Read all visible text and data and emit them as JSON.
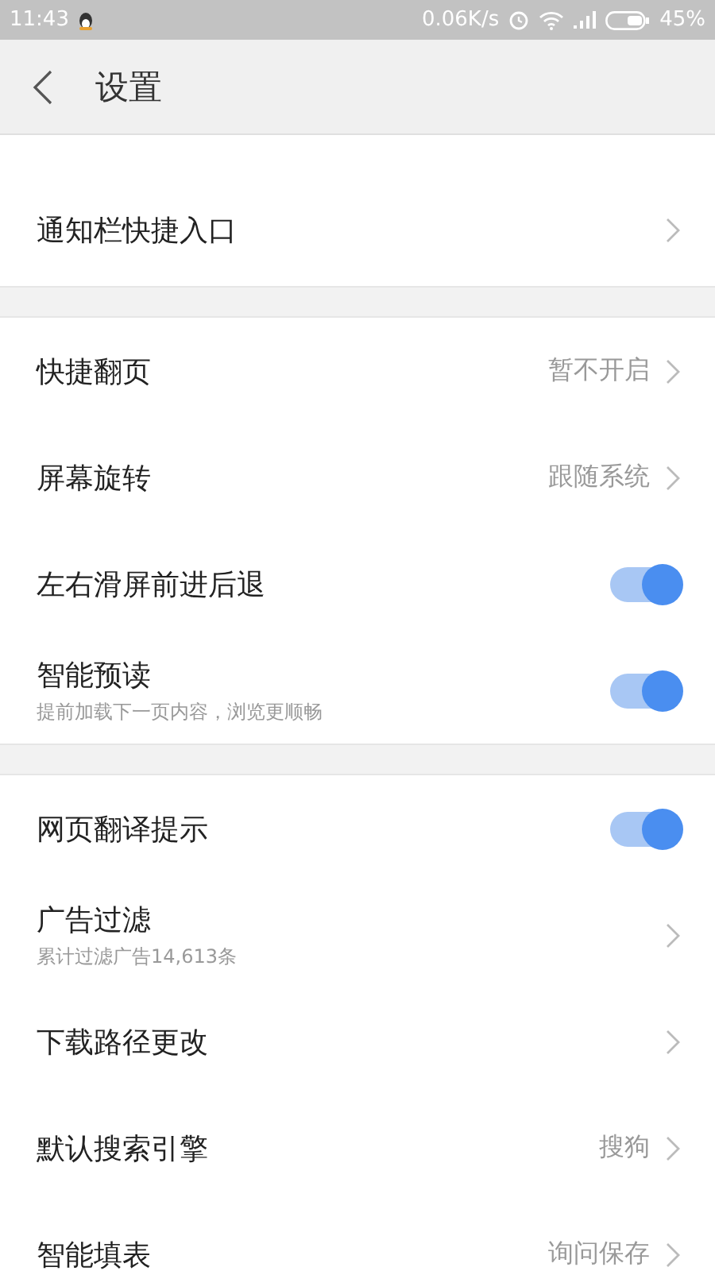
{
  "status_bar": {
    "time": "11:43",
    "speed": "0.06K/s",
    "battery": "45%"
  },
  "header": {
    "title": "设置"
  },
  "sections": [
    {
      "items": [
        {
          "kind": "link",
          "label": "通知栏快捷入口"
        }
      ]
    },
    {
      "items": [
        {
          "kind": "link",
          "label": "快捷翻页",
          "value": "暂不开启"
        },
        {
          "kind": "link",
          "label": "屏幕旋转",
          "value": "跟随系统"
        },
        {
          "kind": "toggle",
          "label": "左右滑屏前进后退",
          "on": true
        },
        {
          "kind": "toggle",
          "label": "智能预读",
          "subtitle": "提前加载下一页内容，浏览更顺畅",
          "on": true
        }
      ]
    },
    {
      "items": [
        {
          "kind": "toggle",
          "label": "网页翻译提示",
          "on": true
        },
        {
          "kind": "link",
          "label": "广告过滤",
          "subtitle": "累计过滤广告14,613条"
        },
        {
          "kind": "link",
          "label": "下载路径更改"
        },
        {
          "kind": "link",
          "label": "默认搜索引擎",
          "value": "搜狗"
        },
        {
          "kind": "link",
          "label": "智能填表",
          "value": "询问保存"
        }
      ]
    }
  ]
}
